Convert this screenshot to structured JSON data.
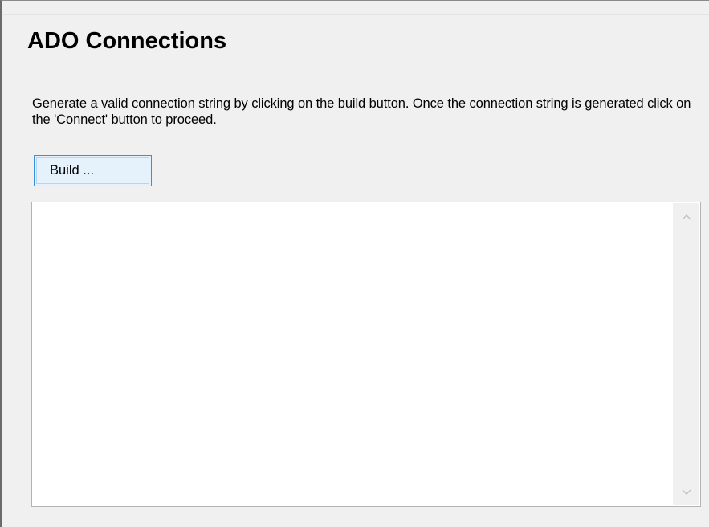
{
  "panel": {
    "title": "ADO Connections",
    "description": "Generate a valid connection string by clicking on the build button.  Once the connection string is generated click on the 'Connect' button to proceed.",
    "build_button_label": "Build ...",
    "connection_string_value": ""
  },
  "scrollbar": {
    "up_icon": "chevron-up-icon",
    "down_icon": "chevron-down-icon"
  },
  "colors": {
    "window_background": "#f0f0f0",
    "button_border": "#3c90d9",
    "button_background": "#e5f1fb",
    "textarea_border": "#b4b4b4"
  }
}
